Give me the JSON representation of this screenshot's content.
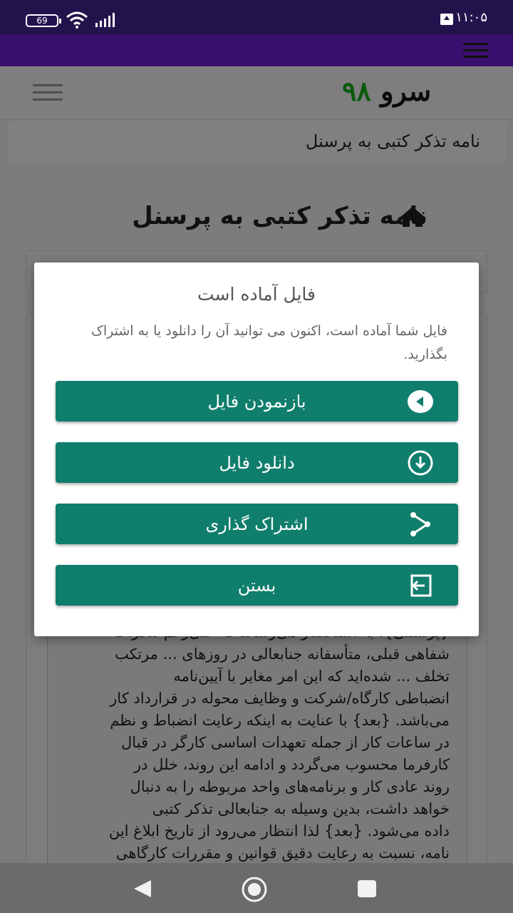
{
  "status_bar": {
    "time": "۱۱:۰۵",
    "battery": "69"
  },
  "site": {
    "logo_text": "سرو",
    "logo_num": "۹۸",
    "breadcrumb": "نامه تذکر کتبی به پرسنل",
    "page_title": "نامه تذکر کتبی به پرسنل"
  },
  "document": {
    "lines": [
      "{پرسنلی}، به استحضار می‌رساند که علی‌رغم تذکرات",
      "شفاهی قبلی، متأسفانه جنابعالی در روزهای ...  مرتکب",
      "تخلف ...  شده‌اید که این امر مغایر با آیین‌نامه",
      "انضباطی کارگاه/شرکت و وظایف محوله در قرارداد کار",
      "می‌باشد. {بعد} با عنایت به اینکه رعایت انضباط و نظم",
      "در ساعات کار از جمله تعهدات اساسی کارگر در قبال",
      "کارفرما محسوب می‌گردد و ادامه این روند، خلل در",
      "روند عادی کار و برنامه‌های واحد مربوطه را به دنبال",
      "خواهد داشت، بدین وسیله به جنابعالی تذکر کتبی",
      "داده می‌شود. {بعد} لذا انتظار می‌رود از تاریخ ابلاغ این",
      "نامه، نسبت به رعایت دقیق قوانین و مقررات کارگاهی"
    ]
  },
  "modal": {
    "title": "فایل آماده است",
    "message": "فایل شما آماده است، اکنون می توانید آن را دانلود یا به اشتراک بگذارید.",
    "buttons": {
      "open": "بازنمودن فایل",
      "download": "دانلود فایل",
      "share": "اشتراک گذاری",
      "close": "بستن"
    },
    "accent_color": "#107e6c"
  }
}
